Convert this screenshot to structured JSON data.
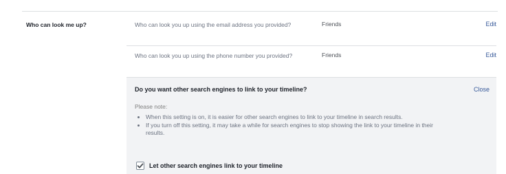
{
  "section": {
    "label": "Who can look me up?"
  },
  "rows": [
    {
      "question": "Who can look you up using the email address you provided?",
      "value": "Friends",
      "action": "Edit"
    },
    {
      "question": "Who can look you up using the phone number you provided?",
      "value": "Friends",
      "action": "Edit"
    }
  ],
  "search_engines": {
    "title": "Do you want other search engines to link to your timeline?",
    "close": "Close",
    "note": "Please note:",
    "bullets": [
      "When this setting is on, it is easier for other search engines to link to your timeline in search results.",
      "If you turn off this setting, it may take a while for search engines to stop showing the link to your timeline in their results."
    ],
    "checkbox_label": "Let other search engines link to your timeline",
    "checkbox_checked": true
  },
  "colors": {
    "link": "#365899",
    "panel_bg": "#f2f3f5",
    "divider": "#dddfe2"
  },
  "icons": {
    "checkbox": "check-mark"
  }
}
